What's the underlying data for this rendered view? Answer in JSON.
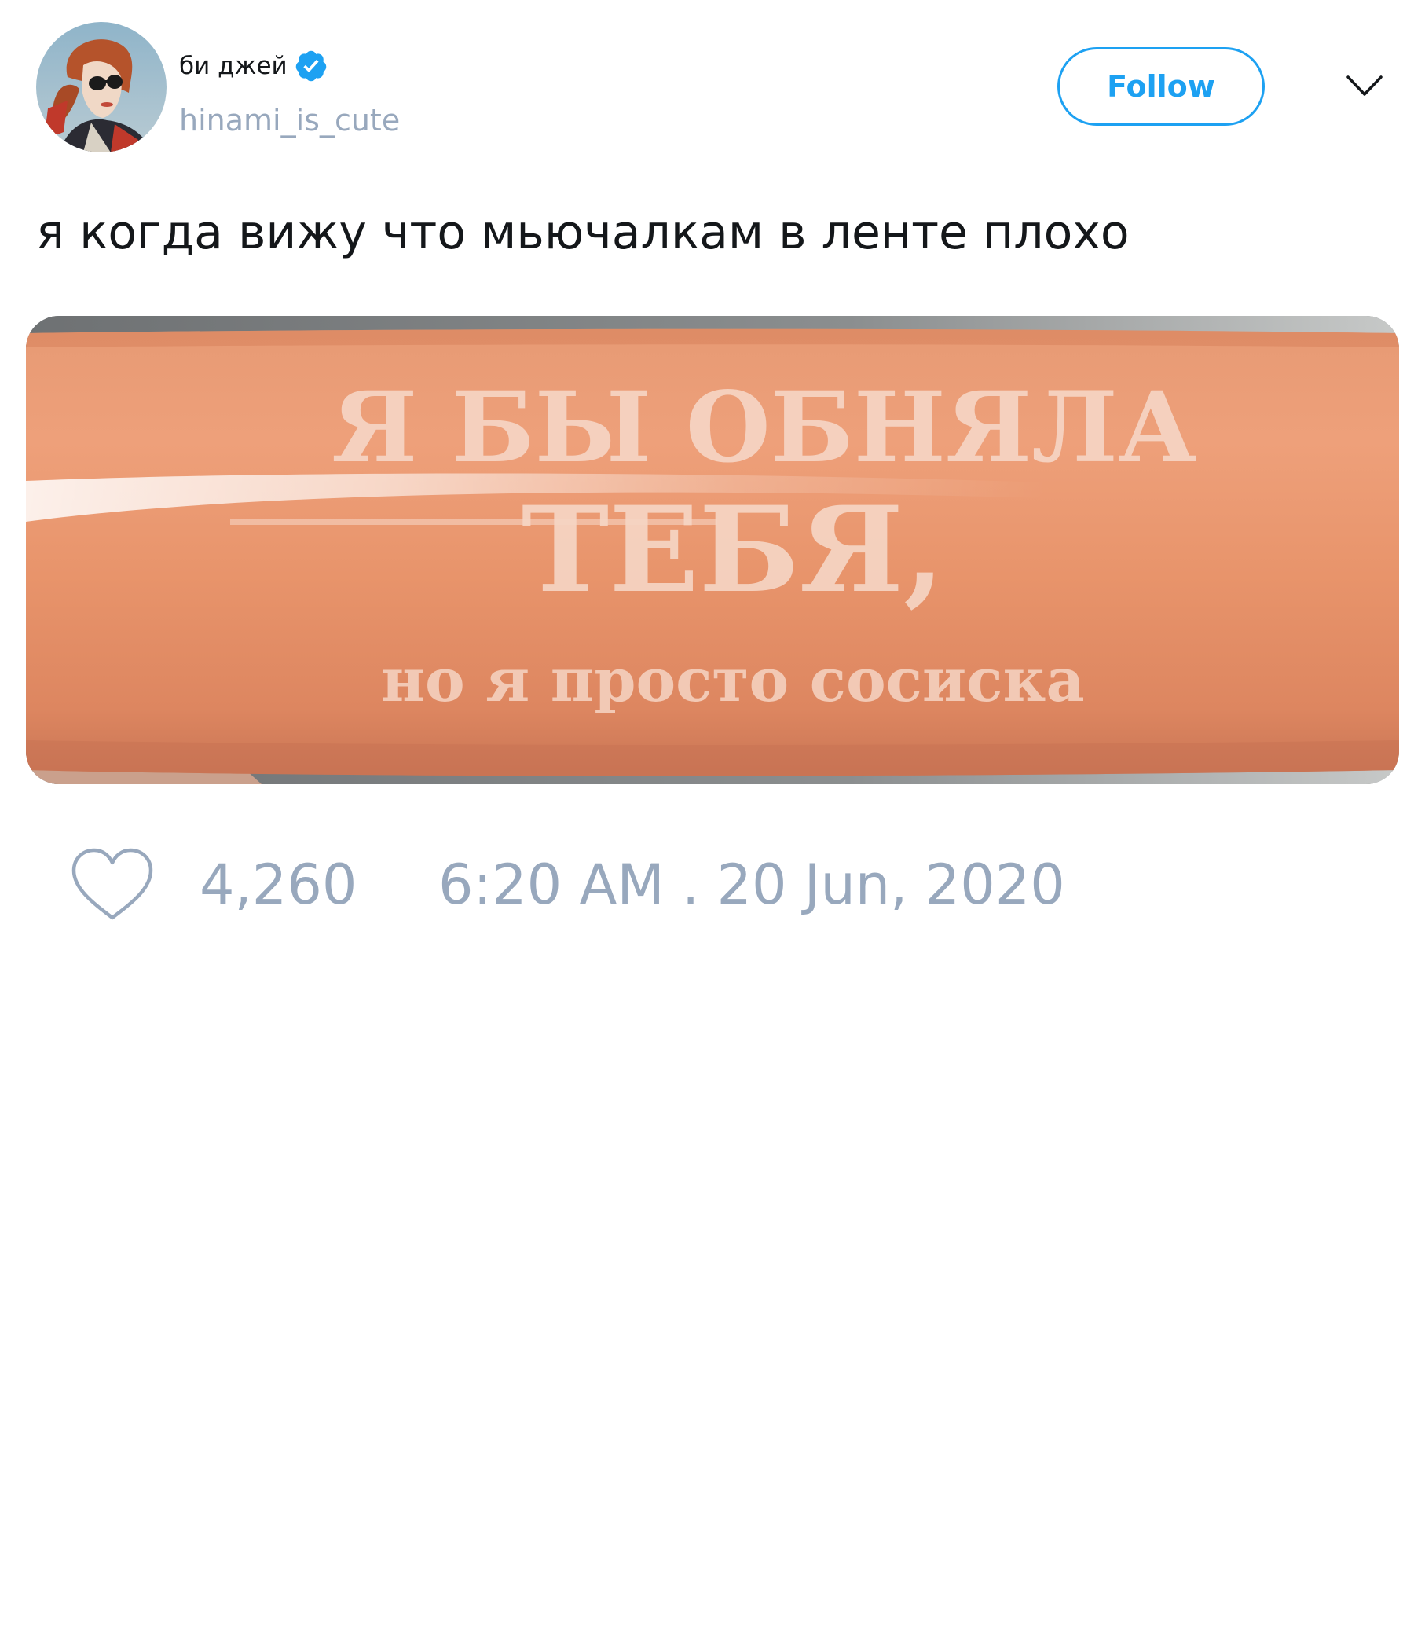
{
  "user": {
    "display_name": "би джей",
    "handle": "hinami_is_cute",
    "verified": true,
    "avatar_icon": "profile-photo"
  },
  "header": {
    "follow_label": "Follow",
    "menu_icon": "chevron-down-icon"
  },
  "tweet": {
    "text": "я когда вижу что мьючалкам в ленте плохо",
    "media": {
      "line1": "Я БЫ ОБНЯЛА",
      "line2": "ТЕБЯ,",
      "line3": "но я просто сосиска"
    },
    "like_count": "4,260",
    "timestamp": "6:20 AM . 20 Jun, 2020"
  },
  "colors": {
    "accent": "#1da1f2",
    "muted_text": "#98a8bd",
    "main_text": "#14171a",
    "sausage": "#e8936a"
  }
}
